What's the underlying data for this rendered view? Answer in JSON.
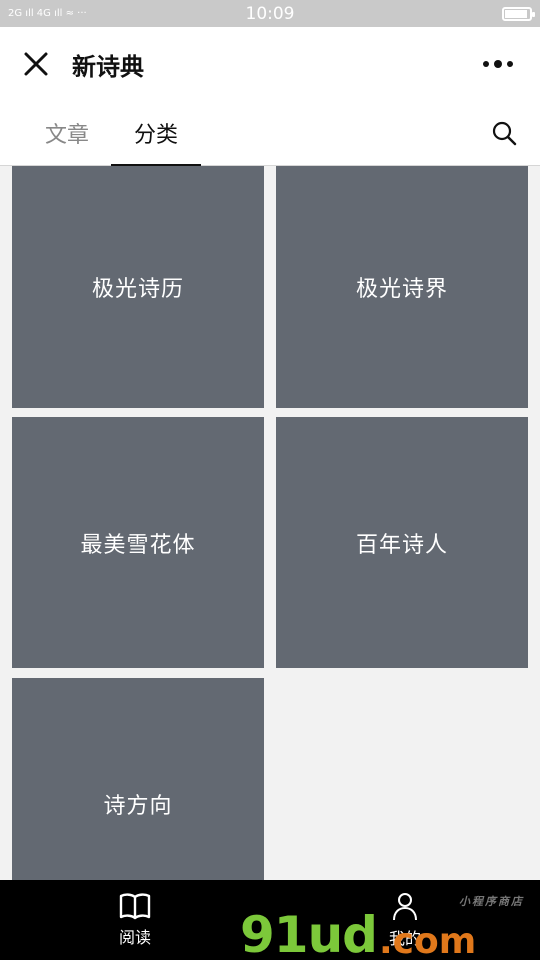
{
  "status_bar": {
    "time": "10:09",
    "signal_left": "2G ıll 4G ıll ≈ ···"
  },
  "nav": {
    "title": "新诗典"
  },
  "tabs": [
    {
      "label": "文章",
      "active": false
    },
    {
      "label": "分类",
      "active": true
    }
  ],
  "tiles": [
    {
      "label": "极光诗历"
    },
    {
      "label": "极光诗界"
    },
    {
      "label": "最美雪花体"
    },
    {
      "label": "百年诗人"
    },
    {
      "label": "诗方向"
    }
  ],
  "bottom_nav": {
    "read_label": "阅读",
    "mine_label": "我的"
  },
  "watermark": {
    "main": "91ud",
    "suffix": ".com",
    "tag": "小程序商店"
  },
  "colors": {
    "tile_bg": "#636972",
    "bottom_nav_bg": "#000000",
    "watermark_green": "#7cc83a",
    "watermark_orange": "#e0781b"
  }
}
